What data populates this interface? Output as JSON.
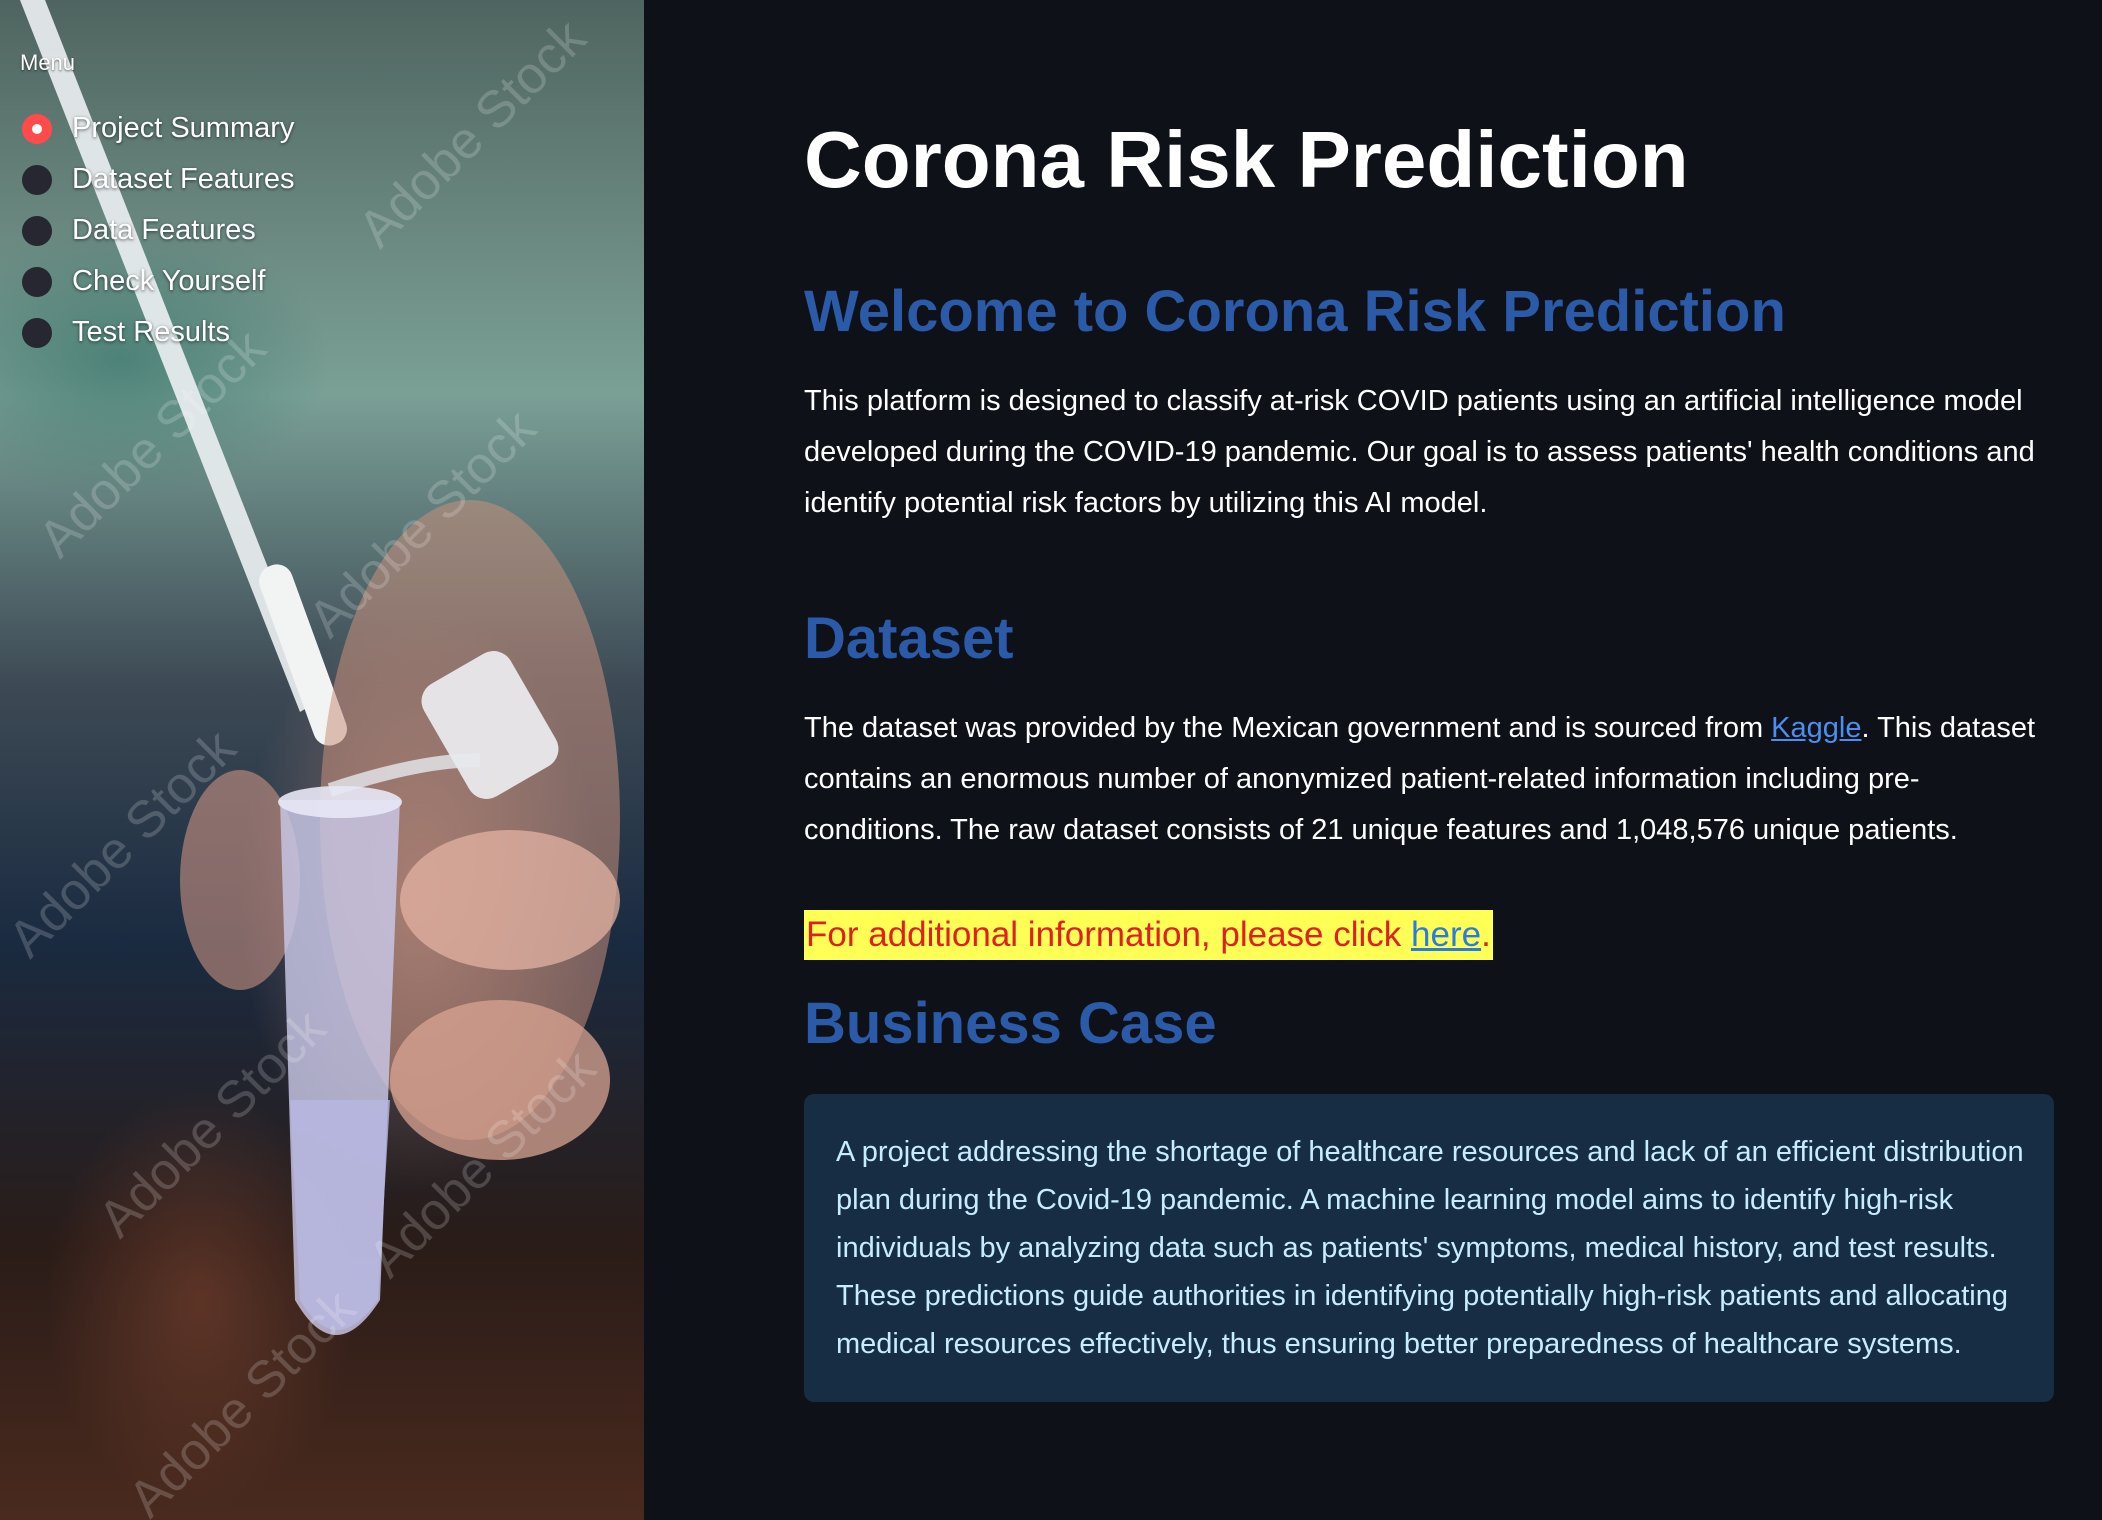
{
  "sidebar": {
    "menu_title": "Menu",
    "items": [
      {
        "label": "Project Summary",
        "selected": true
      },
      {
        "label": "Dataset Features",
        "selected": false
      },
      {
        "label": "Data Features",
        "selected": false
      },
      {
        "label": "Check Yourself",
        "selected": false
      },
      {
        "label": "Test Results",
        "selected": false
      }
    ],
    "background_image": "covid-swab-test-tube-photo",
    "watermark": "Adobe Stock"
  },
  "main": {
    "title": "Corona Risk Prediction",
    "welcome": {
      "heading": "Welcome to Corona Risk Prediction",
      "text": "This platform is designed to classify at-risk COVID patients using an artificial intelligence model developed during the COVID-19 pandemic. Our goal is to assess patients' health conditions and identify potential risk factors by utilizing this AI model."
    },
    "dataset": {
      "heading": "Dataset",
      "text_before": "The dataset was provided by the Mexican government and is sourced from ",
      "link_label": "Kaggle",
      "text_after": ". This dataset contains an enormous number of anonymized patient-related information including pre-conditions. The raw dataset consists of 21 unique features and 1,048,576 unique patients."
    },
    "additional_info": {
      "text_before": "For additional information, please click ",
      "link_label": "here",
      "text_after": "."
    },
    "business_case": {
      "heading": "Business Case",
      "text": "A project addressing the shortage of healthcare resources and lack of an efficient distribution plan during the Covid-19 pandemic. A machine learning model aims to identify high-risk individuals by analyzing data such as patients' symptoms, medical history, and test results. These predictions guide authorities in identifying potentially high-risk patients and allocating medical resources effectively, thus ensuring better preparedness of healthcare systems."
    }
  },
  "colors": {
    "background": "#0e1117",
    "heading_blue": "#2a5aa8",
    "radio_selected": "#ff4b4b",
    "info_box_bg": "#172d43",
    "highlight_bg": "#ffff55",
    "highlight_text": "#e02020",
    "link": "#4a8ef0"
  }
}
